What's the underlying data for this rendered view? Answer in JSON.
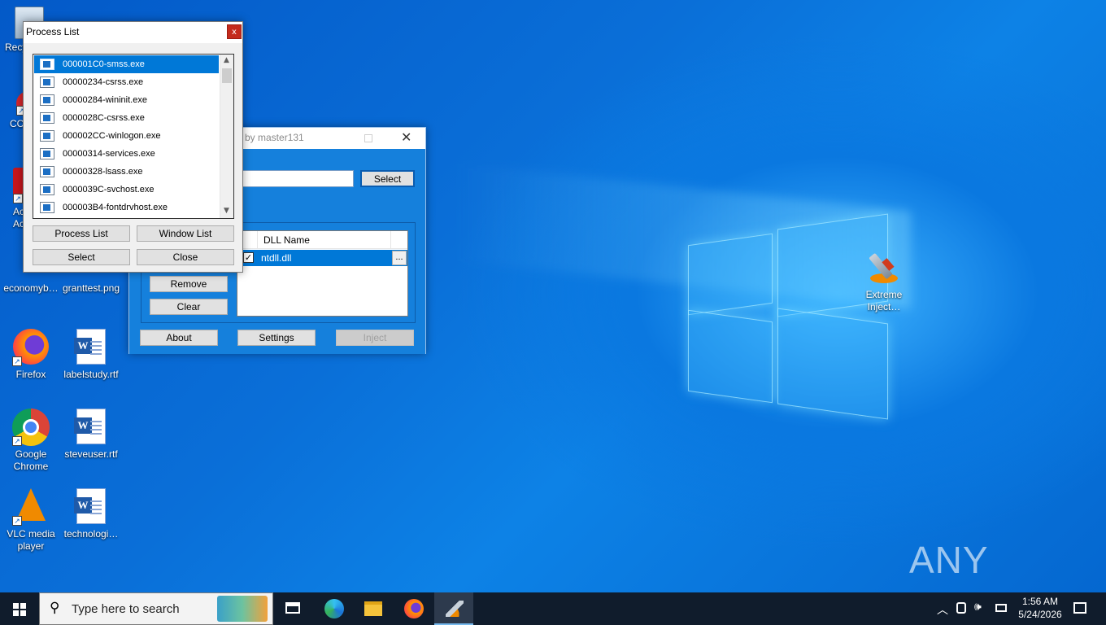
{
  "desktop": {
    "icons": [
      {
        "label": "Recy…"
      },
      {
        "label": "CC…"
      },
      {
        "label": "Ac… Ac…"
      },
      {
        "label": "economyb…"
      },
      {
        "label": "granttest.png"
      },
      {
        "label": "Firefox"
      },
      {
        "label": "labelstudy.rtf"
      },
      {
        "label": "Google Chrome"
      },
      {
        "label": "steveuser.rtf"
      },
      {
        "label": "VLC media player"
      },
      {
        "label": "technologi…"
      },
      {
        "label": "Extreme Inject…"
      }
    ],
    "watermark": "ANY RUN"
  },
  "injector_window": {
    "title": "3 by master131",
    "select_button": "Select",
    "dll_table": {
      "header": "DLL Name",
      "rows": [
        {
          "name": "ntdll.dll",
          "checked": true,
          "browse": "..."
        }
      ]
    },
    "remove_button": "Remove",
    "clear_button": "Clear",
    "about_button": "About",
    "settings_button": "Settings",
    "inject_button": "Inject"
  },
  "process_list_window": {
    "title": "Process List",
    "close_glyph": "x",
    "processes": [
      "000001C0-smss.exe",
      "00000234-csrss.exe",
      "00000284-wininit.exe",
      "0000028C-csrss.exe",
      "000002CC-winlogon.exe",
      "00000314-services.exe",
      "00000328-lsass.exe",
      "0000039C-svchost.exe",
      "000003B4-fontdrvhost.exe"
    ],
    "selected_index": 0,
    "process_list_button": "Process List",
    "window_list_button": "Window List",
    "select_button": "Select",
    "close_button": "Close"
  },
  "taskbar": {
    "search_placeholder": "Type here to search",
    "time": "1:56 AM",
    "date": "5/24/2026"
  },
  "colors": {
    "accent": "#0078d7",
    "taskbar": "#101c2c"
  }
}
